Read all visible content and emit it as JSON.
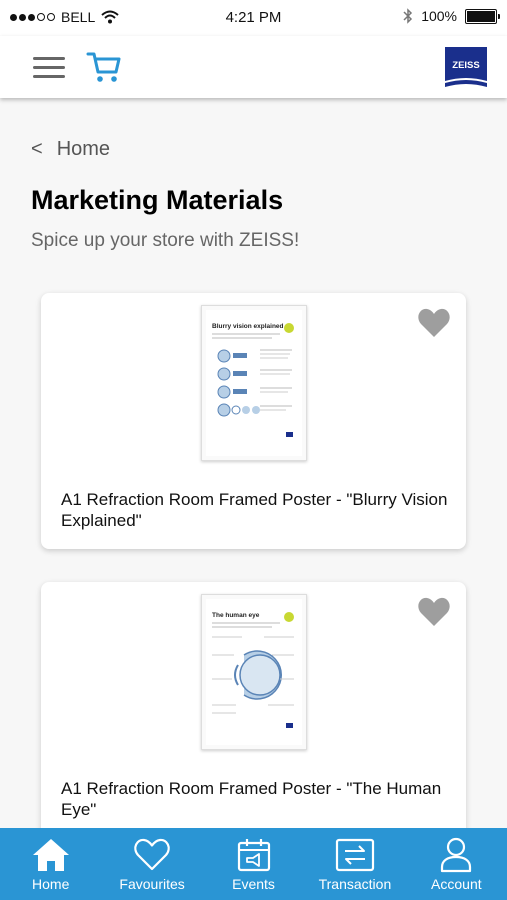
{
  "status_bar": {
    "carrier": "BELL",
    "time": "4:21 PM",
    "battery": "100%",
    "battery_level": 1.0
  },
  "header": {
    "menu_icon": "hamburger-icon",
    "cart_icon": "cart-icon",
    "logo_text": "ZEISS"
  },
  "breadcrumb": {
    "chevron": "<",
    "label": "Home"
  },
  "page": {
    "title": "Marketing Materials",
    "subtitle": "Spice up your store with ZEISS!"
  },
  "products": [
    {
      "title": "A1 Refraction Room Framed Poster - \"Blurry Vision Explained\"",
      "poster_heading": "Blurry vision explained",
      "favourite_icon": "heart-icon"
    },
    {
      "title": "A1 Refraction Room Framed Poster - \"The Human Eye\"",
      "poster_heading": "The human eye",
      "favourite_icon": "heart-icon"
    }
  ],
  "bottom_nav": [
    {
      "label": "Home",
      "icon": "home-icon"
    },
    {
      "label": "Favourites",
      "icon": "heart-icon"
    },
    {
      "label": "Events",
      "icon": "calendar-icon"
    },
    {
      "label": "Transaction",
      "icon": "transaction-icon"
    },
    {
      "label": "Account",
      "icon": "account-icon"
    }
  ],
  "colors": {
    "accent": "#2a95d4",
    "logo_blue": "#1a2f8c",
    "heart_gray": "#9e9e9e",
    "poster_badge": "#c8d832"
  }
}
